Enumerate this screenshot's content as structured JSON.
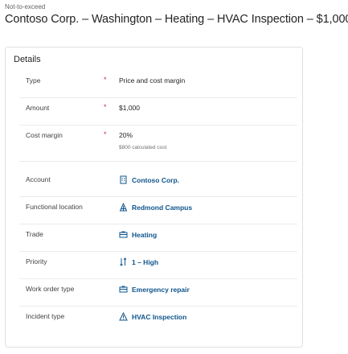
{
  "header": {
    "eyebrow": "Not-to-exceed",
    "title": "Contoso Corp. – Washington – Heating – HVAC Inspection – $1,000"
  },
  "details": {
    "heading": "Details",
    "required_mark": "*",
    "fields": {
      "type": {
        "label": "Type",
        "value": "Price and cost margin"
      },
      "amount": {
        "label": "Amount",
        "value": "$1,000"
      },
      "cost_margin": {
        "label": "Cost margin",
        "value": "20%",
        "hint": "$800 calculated cost"
      },
      "account": {
        "label": "Account",
        "value": "Contoso Corp.",
        "icon": "account-icon"
      },
      "functional_location": {
        "label": "Functional location",
        "value": "Redmond Campus",
        "icon": "location-icon"
      },
      "trade": {
        "label": "Trade",
        "value": "Heating",
        "icon": "trade-icon"
      },
      "priority": {
        "label": "Priority",
        "value": "1 – High",
        "icon": "priority-icon"
      },
      "work_order_type": {
        "label": "Work order type",
        "value": "Emergency repair",
        "icon": "work-order-type-icon"
      },
      "incident_type": {
        "label": "Incident type",
        "value": "HVAC Inspection",
        "icon": "warning-icon"
      }
    }
  },
  "colors": {
    "link": "#0f548c",
    "required": "#c4314b",
    "border": "#e0e0e0"
  }
}
